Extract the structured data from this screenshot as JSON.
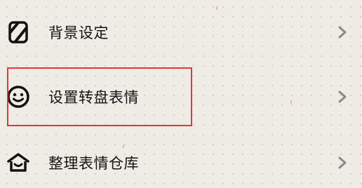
{
  "menu": {
    "items": [
      {
        "label": "背景设定",
        "icon": "striped-square-icon"
      },
      {
        "label": "设置转盘表情",
        "icon": "smiley-icon"
      },
      {
        "label": "整理表情仓库",
        "icon": "warehouse-icon"
      }
    ]
  },
  "highlight": {
    "color": "#e0373c",
    "target": "设置转盘表情"
  },
  "colors": {
    "background": "#eeece4",
    "text": "#141414",
    "chevron": "#8a8a8a"
  }
}
